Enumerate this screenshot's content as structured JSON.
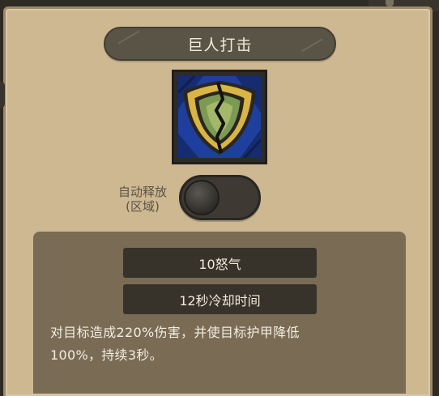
{
  "skill": {
    "title": "巨人打击",
    "icon": "cracked-shield-icon"
  },
  "auto_cast": {
    "label_line1": "自动释放",
    "label_line2": "(区域)",
    "enabled": false
  },
  "stats": {
    "cost": "10怒气",
    "cooldown": "12秒冷却时间"
  },
  "description": {
    "line1": "对目标造成220%伤害，并使目标护甲降低",
    "line2": "100%，持续3秒。"
  },
  "colors": {
    "panel_bg": "#cdb892",
    "title_plate": "#5a5446",
    "info_box": "#7a6b55",
    "stat_bar": "#37332b",
    "icon_bg_blue": "#1f3f9e",
    "icon_shield_gold": "#d8b544",
    "icon_shield_green": "#7d9a55"
  }
}
